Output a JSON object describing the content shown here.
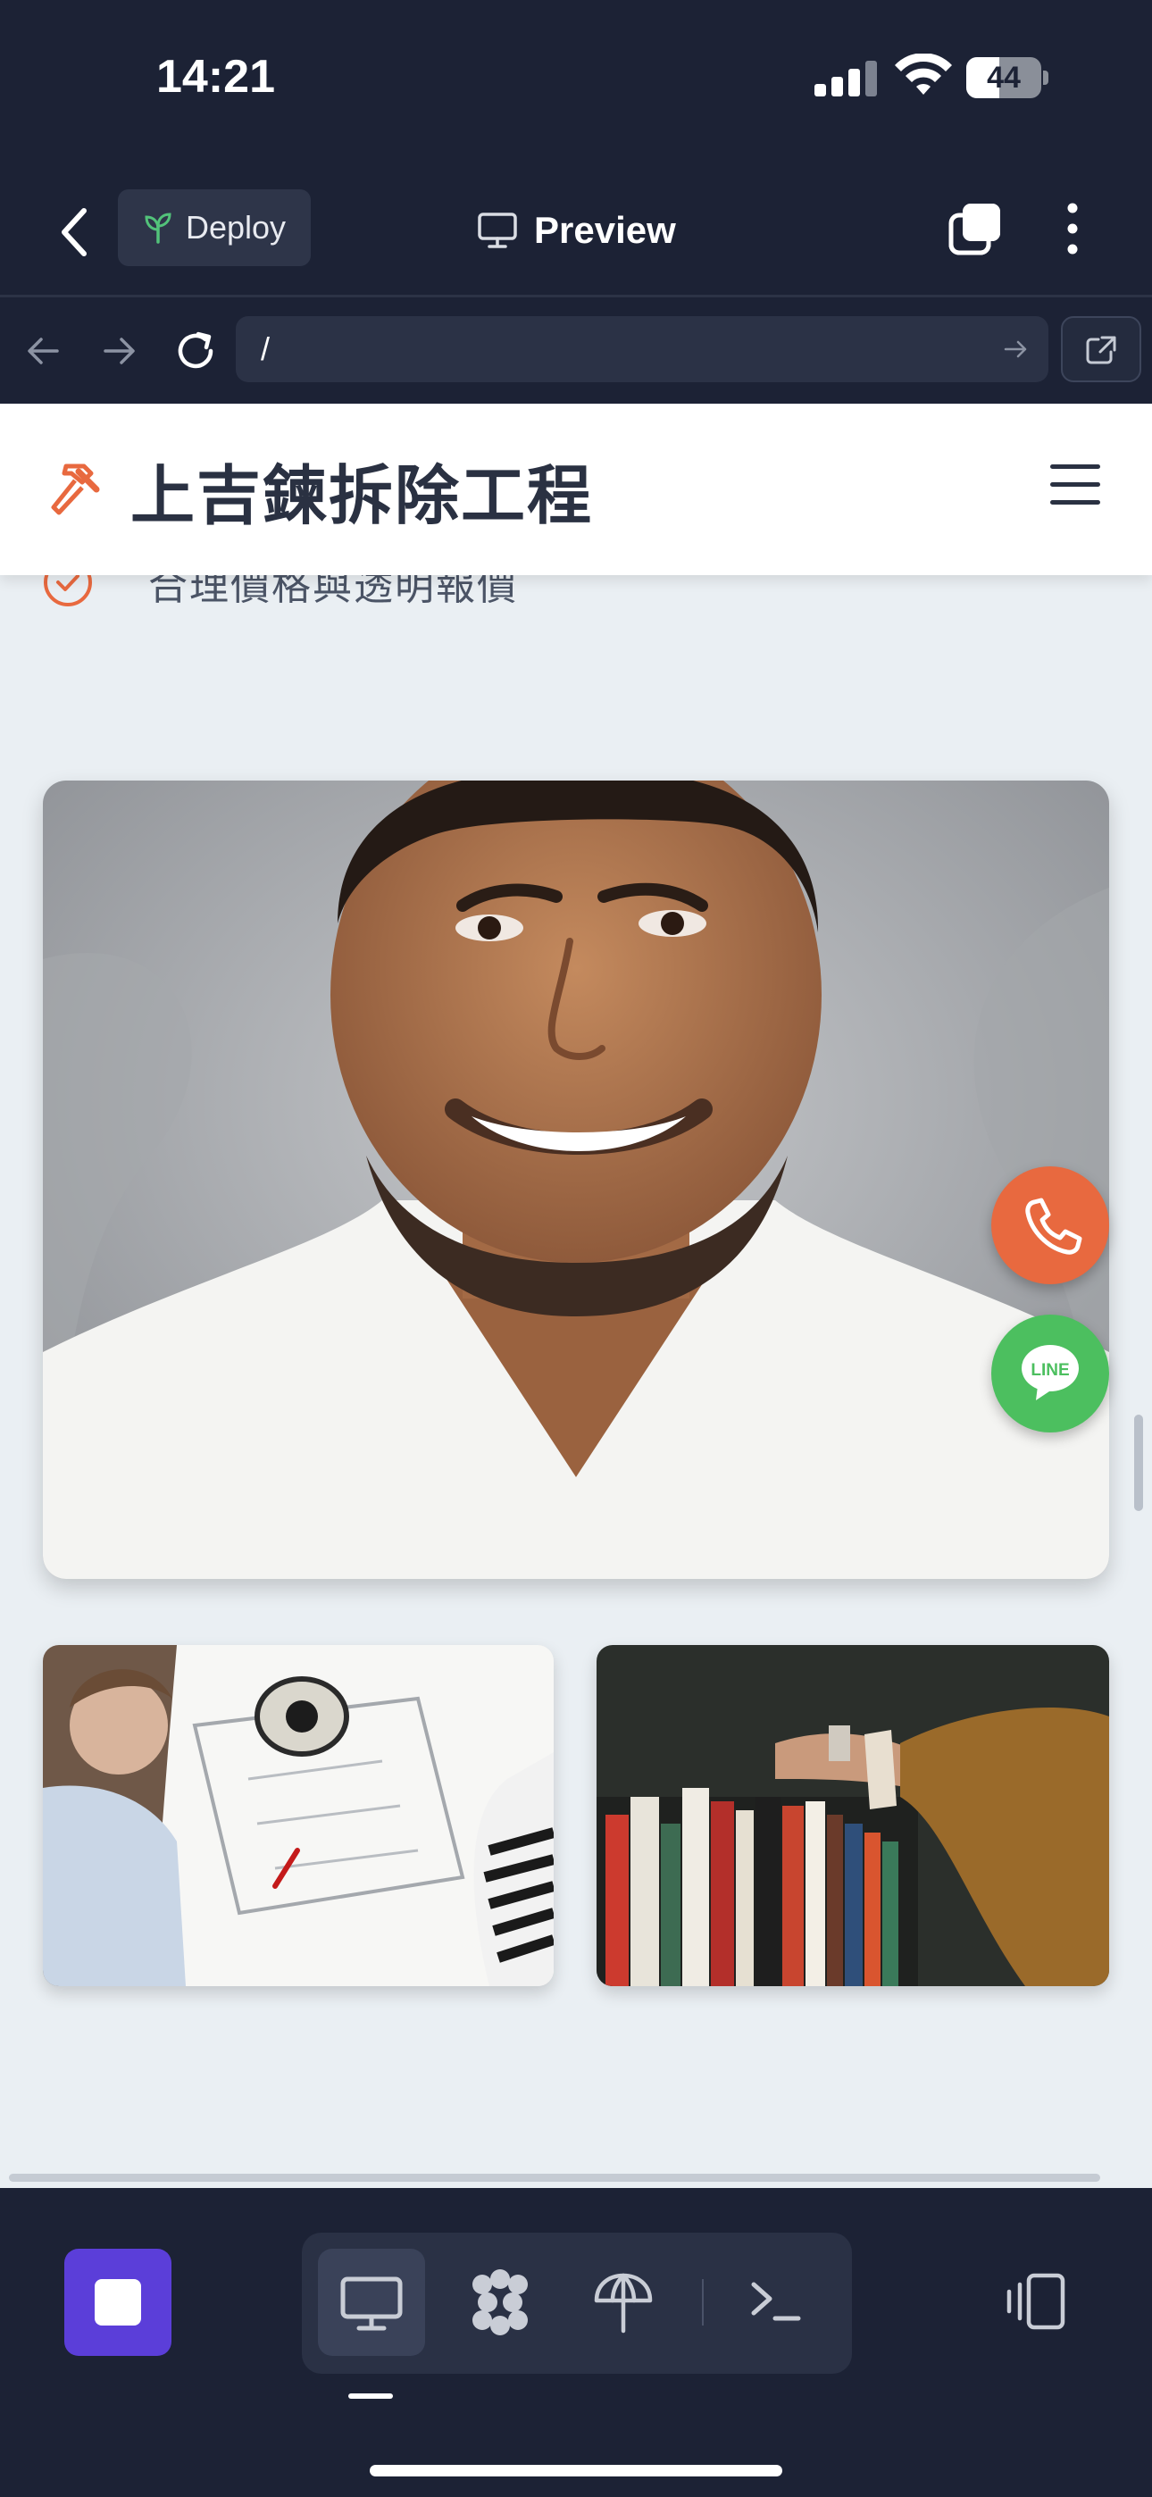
{
  "status_bar": {
    "time": "14:21",
    "battery": "44",
    "battery_level": 0.44
  },
  "app_header": {
    "deploy_label": "Deploy",
    "title": "Preview",
    "icons": [
      "chevron-left-icon",
      "sprout-icon",
      "monitor-icon",
      "tabs-icon",
      "more-vertical-icon"
    ]
  },
  "url_bar": {
    "url": "/",
    "icons": [
      "arrow-left-icon",
      "arrow-right-icon",
      "reload-icon",
      "go-arrow-icon",
      "external-link-icon"
    ]
  },
  "site": {
    "name": "上吉鍊拆除工程",
    "feature_partial": "合理價格與透明報價",
    "icons": [
      "hammer-icon",
      "hamburger-menu-icon",
      "check-circle-icon"
    ],
    "fab_line_label": "LINE",
    "fab_icons": [
      "phone-icon",
      "line-chat-icon"
    ]
  },
  "bottom_bar": {
    "icons": [
      "stop-icon",
      "monitor-icon",
      "plugins-icon",
      "deploy-umbrella-icon",
      "terminal-icon",
      "devices-icon"
    ]
  },
  "colors": {
    "accent_orange": "#e8693f",
    "line_green": "#4cbf5f",
    "stop_purple": "#5b3ed9",
    "chrome_dark": "#1c2235"
  }
}
